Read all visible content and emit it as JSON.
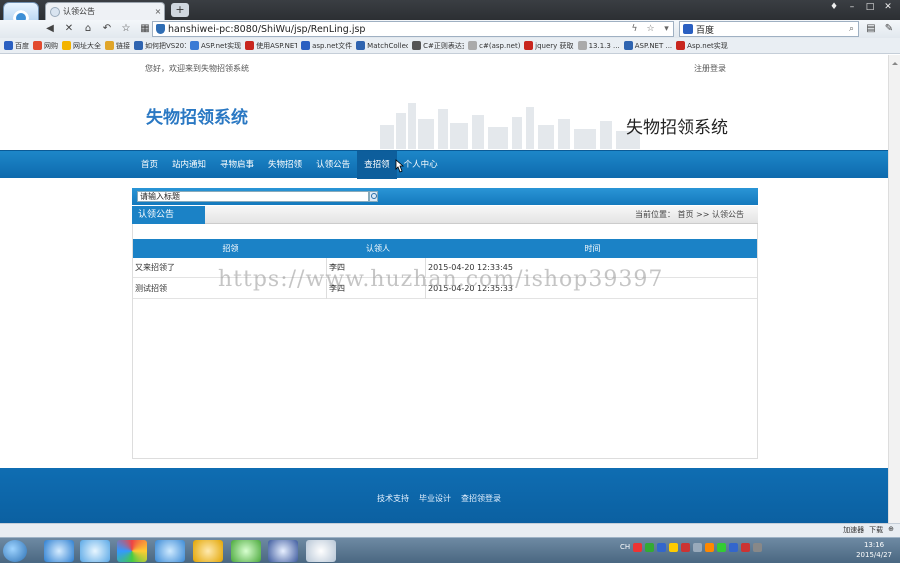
{
  "browser": {
    "tab_title": "认领公告",
    "tab_close": "×",
    "new_tab": "+",
    "address": "hanshiwei-pc:8080/ShiWu/jsp/RenLing.jsp",
    "search_engine": "百度",
    "window_controls": [
      "♦",
      "–",
      "□",
      "✕"
    ]
  },
  "bookmarks": [
    {
      "label": "百度",
      "color": "#2a5fc1"
    },
    {
      "label": "网购",
      "color": "#e24a2e"
    },
    {
      "label": "网址大全",
      "color": "#f3b300"
    },
    {
      "label": "链接",
      "color": "#e0a52a"
    },
    {
      "label": "如何把VS2010",
      "color": "#2f64b0"
    },
    {
      "label": "ASP.net实现",
      "color": "#3a7bd5"
    },
    {
      "label": "使用ASP.NET",
      "color": "#c8261e"
    },
    {
      "label": "asp.net文件",
      "color": "#2a5fc1"
    },
    {
      "label": "MatchCollec",
      "color": "#2f64b0"
    },
    {
      "label": "C#正则表达式",
      "color": "#555"
    },
    {
      "label": "c#(asp.net)",
      "color": "#aaa"
    },
    {
      "label": "jquery 获取",
      "color": "#c8261e"
    },
    {
      "label": "13.1.3 ...",
      "color": "#aaa"
    },
    {
      "label": "ASP.NET ...",
      "color": "#2f64b0"
    },
    {
      "label": "Asp.net实现",
      "color": "#c8261e"
    }
  ],
  "site": {
    "welcome": "您好，欢迎来到失物招领系统",
    "login_link": "注册登录",
    "logo_text": "失物招领系统",
    "title": "失物招领系统",
    "nav": [
      {
        "label": "首页",
        "active": false
      },
      {
        "label": "站内通知",
        "active": false
      },
      {
        "label": "寻物启事",
        "active": false
      },
      {
        "label": "失物招领",
        "active": false
      },
      {
        "label": "认领公告",
        "active": false
      },
      {
        "label": "查招领",
        "active": true
      },
      {
        "label": "个人中心",
        "active": false
      }
    ]
  },
  "search": {
    "value": "请输入标题"
  },
  "section": {
    "tab_label": "认领公告",
    "breadcrumb": "当前位置： 首页 >> 认领公告"
  },
  "table": {
    "headers": [
      "招领",
      "认领人",
      "时间"
    ],
    "rows": [
      {
        "item": "又来招领了",
        "claimant": "李四",
        "time": "2015-04-20 12:33:45"
      },
      {
        "item": "测试招领",
        "claimant": "李四",
        "time": "2015-04-20 12:35:33"
      }
    ]
  },
  "watermark": "https://www.huzhan.com/ishop39397",
  "footer": {
    "links": [
      "技术支持",
      "毕业设计",
      "查招领登录"
    ]
  },
  "statusbar": {
    "items": [
      "加速器",
      "下载"
    ]
  },
  "taskbar": {
    "time": "13:16",
    "date": "2015/4/27",
    "lang": "CH"
  }
}
